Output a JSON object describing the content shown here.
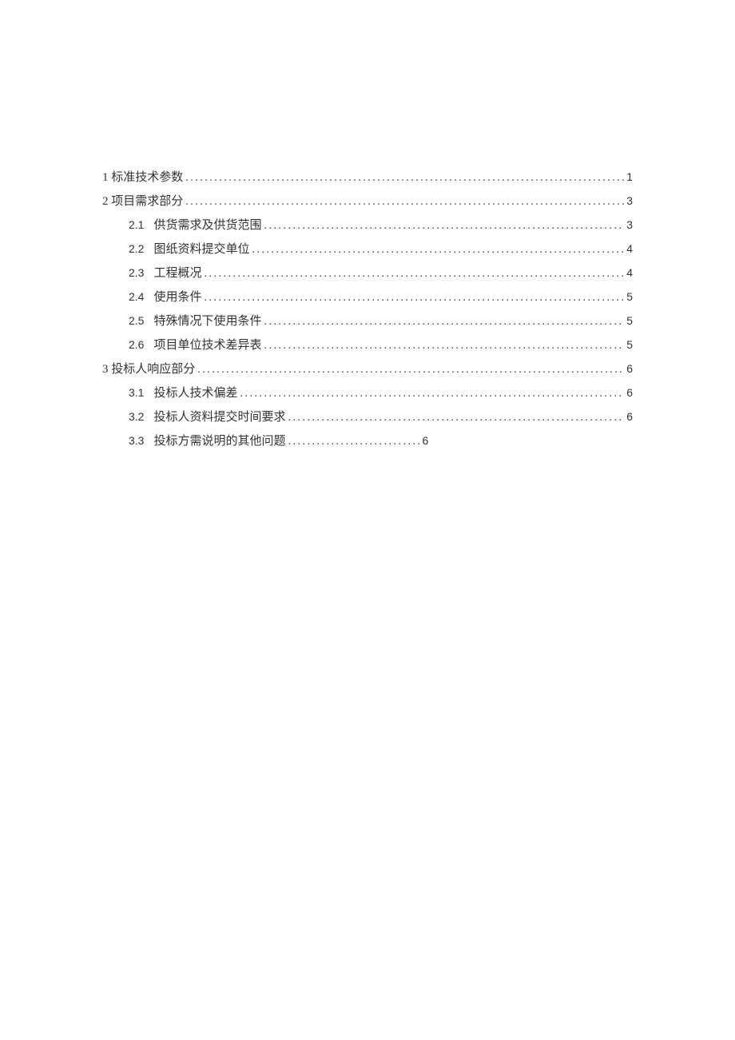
{
  "toc": [
    {
      "level": 1,
      "num": "1",
      "title": "标准技术参数",
      "page": "1",
      "last": false
    },
    {
      "level": 1,
      "num": "2",
      "title": "项目需求部分",
      "page": "3",
      "last": false
    },
    {
      "level": 2,
      "num": "2.1",
      "title": "供货需求及供货范围",
      "page": "3",
      "last": false
    },
    {
      "level": 2,
      "num": "2.2",
      "title": "图纸资料提交单位",
      "page": "4",
      "last": false
    },
    {
      "level": 2,
      "num": "2.3",
      "title": "工程概况",
      "page": "4",
      "last": false
    },
    {
      "level": 2,
      "num": "2.4",
      "title": "使用条件",
      "page": "5",
      "last": false
    },
    {
      "level": 2,
      "num": "2.5",
      "title": "特殊情况下使用条件",
      "page": "5",
      "last": false
    },
    {
      "level": 2,
      "num": "2.6",
      "title": "项目单位技术差异表",
      "page": "5",
      "last": false
    },
    {
      "level": 1,
      "num": "3",
      "title": "投标人响应部分",
      "page": "6",
      "last": false
    },
    {
      "level": 2,
      "num": "3.1",
      "title": "投标人技术偏差",
      "page": "6",
      "last": false
    },
    {
      "level": 2,
      "num": "3.2",
      "title": "投标人资料提交时间要求",
      "page": "6",
      "last": false
    },
    {
      "level": 2,
      "num": "3.3",
      "title": "投标方需说明的其他问题",
      "page": "6",
      "last": true
    }
  ]
}
